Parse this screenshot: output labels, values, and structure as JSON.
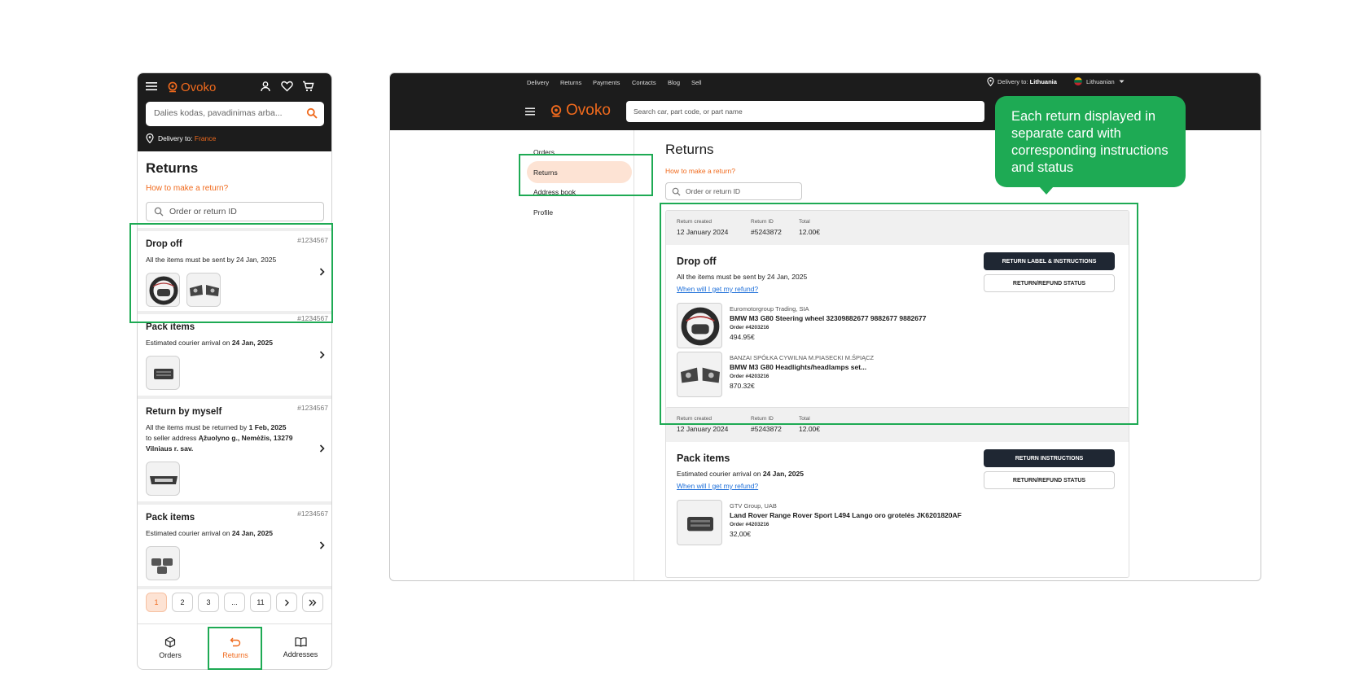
{
  "mobile": {
    "logo": "Ovoko",
    "search_placeholder": "Dalies kodas, pavadinimas arba...",
    "delivery_label": "Delivery to:",
    "delivery_country": "France",
    "page_title": "Returns",
    "how_to": "How to make a return?",
    "id_placeholder": "Order or return ID",
    "cards": [
      {
        "title": "Drop off",
        "number": "#1234567",
        "subtitle": "All the items must be sent by 24 Jan, 2025"
      },
      {
        "title": "Pack items",
        "number": "#1234567",
        "subtitle_prefix": "Estimated courier arrival on ",
        "subtitle_bold": "24 Jan, 2025"
      },
      {
        "title": "Return by myself",
        "number": "#1234567",
        "line1_prefix": "All the items must be returned by ",
        "line1_bold": "1 Feb, 2025",
        "line2_prefix": "to seller address ",
        "line2_bold": "Ąžuolyno g., Nemėžis, 13279",
        "line3_bold": "Vilniaus r. sav."
      },
      {
        "title": "Pack items",
        "number": "#1234567",
        "subtitle_prefix": "Estimated courier arrival on ",
        "subtitle_bold": "24 Jan, 2025"
      }
    ],
    "pager": [
      "1",
      "2",
      "3",
      "...",
      "11"
    ],
    "bottom_nav": {
      "orders": "Orders",
      "returns": "Returns",
      "addresses": "Addresses"
    }
  },
  "desktop": {
    "top_links": [
      "Delivery",
      "Returns",
      "Payments",
      "Contacts",
      "Blog",
      "Sell"
    ],
    "delivery_label": "Delivery to:",
    "delivery_country": "Lithuania",
    "language": "Lithuanian",
    "logo": "Ovoko",
    "search_placeholder": "Search car,  part code, or part name",
    "sidebar": [
      "Orders",
      "Returns",
      "Address book",
      "Profile"
    ],
    "page_title": "Returns",
    "how_to": "How to make a return?",
    "id_placeholder": "Order or return ID",
    "meta_labels": {
      "created": "Return created",
      "id": "Return ID",
      "total": "Total"
    },
    "cards": [
      {
        "created": "12 January 2024",
        "return_id": "#5243872",
        "total": "12.00€",
        "title": "Drop off",
        "subtitle": "All the items must be sent by 24 Jan, 2025",
        "link": "When will I get my refund?",
        "primary_btn": "RETURN LABEL & INSTRUCTIONS",
        "secondary_btn": "RETURN/REFUND STATUS",
        "products": [
          {
            "seller": "Euromotorgroup Trading, SIA",
            "name": "BMW M3 G80 Steering wheel 32309882677 9882677 9882677",
            "order": "Order #4203216",
            "price": "494.95€"
          },
          {
            "seller": "BANZAI SPÓŁKA CYWILNA M.PIASECKI M.ŚPIĄCZ",
            "name": "BMW M3 G80 Headlights/headlamps set...",
            "order": "Order #4203216",
            "price": "870.32€"
          }
        ]
      },
      {
        "created": "12 January 2024",
        "return_id": "#5243872",
        "total": "12.00€",
        "title": "Pack items",
        "subtitle_prefix": "Estimated courier arrival on ",
        "subtitle_bold": "24 Jan, 2025",
        "link": "When will I get my refund?",
        "primary_btn": "RETURN INSTRUCTIONS",
        "secondary_btn": "RETURN/REFUND STATUS",
        "products": [
          {
            "seller": "GTV Group, UAB",
            "name": "Land Rover Range Rover Sport L494 Lango oro grotelės JK6201820AF",
            "order": "Order #4203216",
            "price": "32,00€"
          }
        ]
      }
    ]
  },
  "callout": {
    "text": "Each return displayed in separate card with corresponding instructions and status",
    "color": "#1eaa54"
  },
  "colors": {
    "brand": "#f06a1d",
    "header": "#1c1c1c",
    "highlight": "#1eaa54",
    "button_dark": "#1f2733",
    "link": "#1e6fd9"
  }
}
